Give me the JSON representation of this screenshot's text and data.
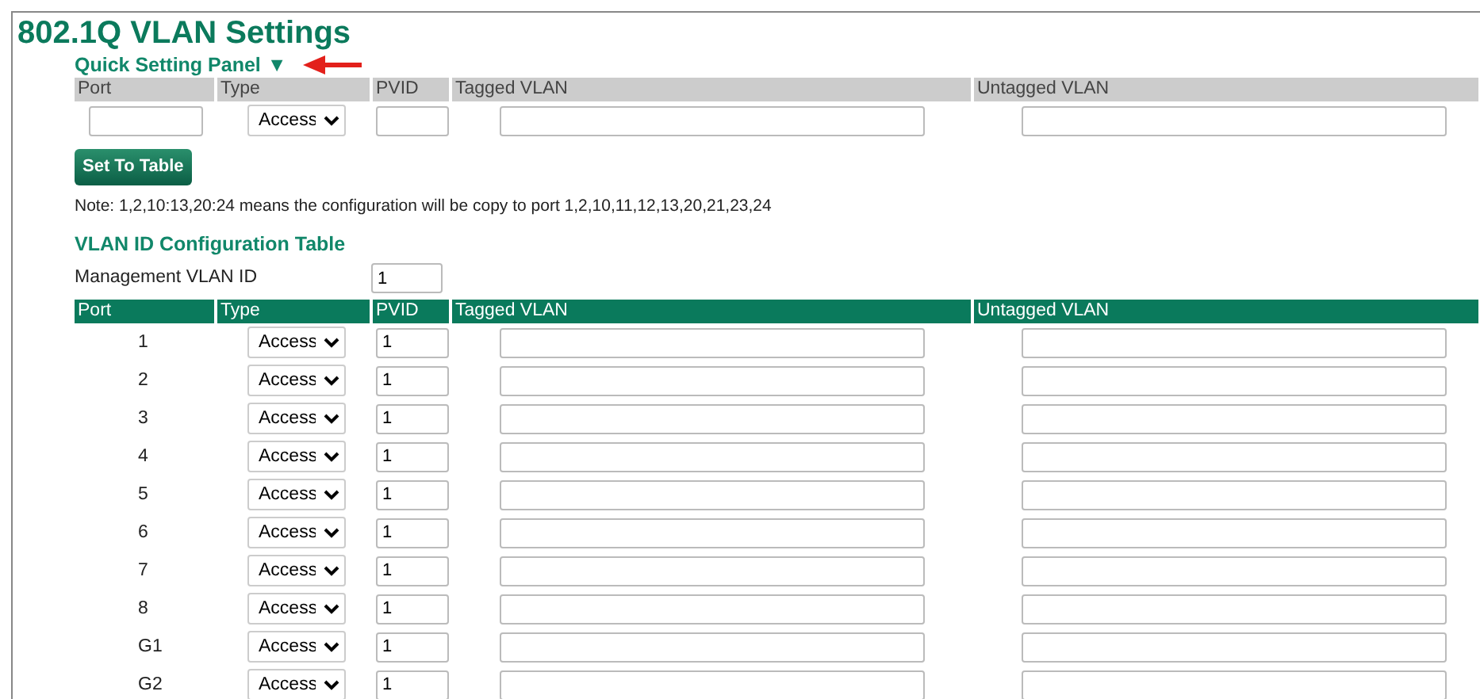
{
  "title": "802.1Q VLAN Settings",
  "quick_panel": {
    "title": "Quick Setting Panel",
    "toggle": "▼",
    "columns": [
      "Port",
      "Type",
      "PVID",
      "Tagged VLAN",
      "Untagged VLAN"
    ],
    "type": "Access",
    "button": "Set To Table",
    "note": "Note: 1,2,10:13,20:24 means the configuration will be copy to port 1,2,10,11,12,13,20,21,23,24"
  },
  "vlan_table": {
    "title": "VLAN ID Configuration Table",
    "management_label": "Management VLAN ID",
    "management_value": "1",
    "columns": [
      "Port",
      "Type",
      "PVID",
      "Tagged VLAN",
      "Untagged VLAN"
    ],
    "rows": [
      {
        "port": "1",
        "type": "Access",
        "pvid": "1"
      },
      {
        "port": "2",
        "type": "Access",
        "pvid": "1"
      },
      {
        "port": "3",
        "type": "Access",
        "pvid": "1"
      },
      {
        "port": "4",
        "type": "Access",
        "pvid": "1"
      },
      {
        "port": "5",
        "type": "Access",
        "pvid": "1"
      },
      {
        "port": "6",
        "type": "Access",
        "pvid": "1"
      },
      {
        "port": "7",
        "type": "Access",
        "pvid": "1"
      },
      {
        "port": "8",
        "type": "Access",
        "pvid": "1"
      },
      {
        "port": "G1",
        "type": "Access",
        "pvid": "1"
      },
      {
        "port": "G2",
        "type": "Access",
        "pvid": "1"
      }
    ]
  }
}
